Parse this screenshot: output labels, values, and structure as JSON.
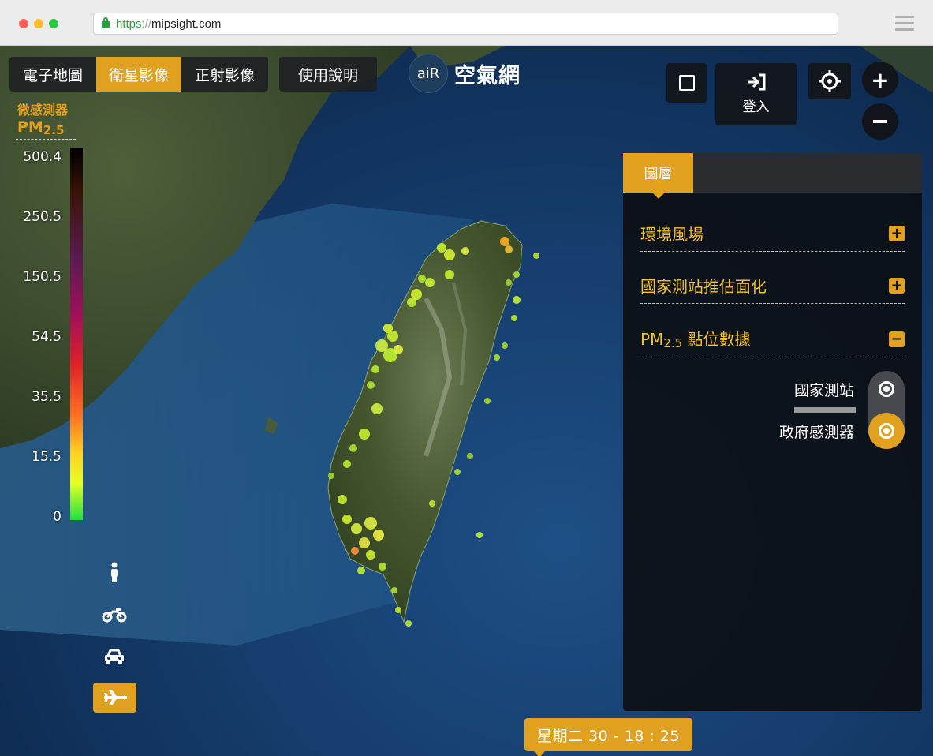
{
  "browser": {
    "url_scheme": "https",
    "url_sep": "://",
    "url_host": "mipsight.com"
  },
  "toolbar": {
    "tabs": [
      {
        "label": "電子地圖",
        "active": false
      },
      {
        "label": "衛星影像",
        "active": true
      },
      {
        "label": "正射影像",
        "active": false
      }
    ],
    "help_label": "使用說明"
  },
  "logo": {
    "badge": "aiR",
    "title": "空氣網"
  },
  "controls": {
    "login_label": "登入"
  },
  "legend": {
    "title": "微感測器",
    "pm_main": "PM",
    "pm_sub": "2.5",
    "ticks": [
      "500.4",
      "250.5",
      "150.5",
      "54.5",
      "35.5",
      "15.5",
      "0"
    ],
    "gradient_colors": [
      "#000000",
      "#3a1408",
      "#5a1a50",
      "#a0105a",
      "#e0202a",
      "#ff7020",
      "#ffd020",
      "#e6ff20",
      "#20e040"
    ]
  },
  "modes": [
    {
      "icon": "person-icon",
      "active": false
    },
    {
      "icon": "motorcycle-icon",
      "active": false
    },
    {
      "icon": "car-icon",
      "active": false
    },
    {
      "icon": "airplane-icon",
      "active": true
    }
  ],
  "panel": {
    "tab_label": "圖層",
    "layers": [
      {
        "label": "環境風場",
        "expanded": false,
        "toggle": "+"
      },
      {
        "label": "國家測站推估面化",
        "expanded": false,
        "toggle": "+"
      },
      {
        "label_main": "PM",
        "label_sub": "2.5",
        "label_rest": " 點位數據",
        "expanded": true,
        "toggle": "−"
      }
    ],
    "sublayers": [
      {
        "label": "國家測站",
        "on": false
      },
      {
        "label": "政府感測器",
        "on": true
      }
    ]
  },
  "timebadge": "星期二 30 - 18 : 25",
  "colors": {
    "accent": "#e0a020",
    "panel_bg": "#0c0e12",
    "layer_label": "#f2c230"
  }
}
